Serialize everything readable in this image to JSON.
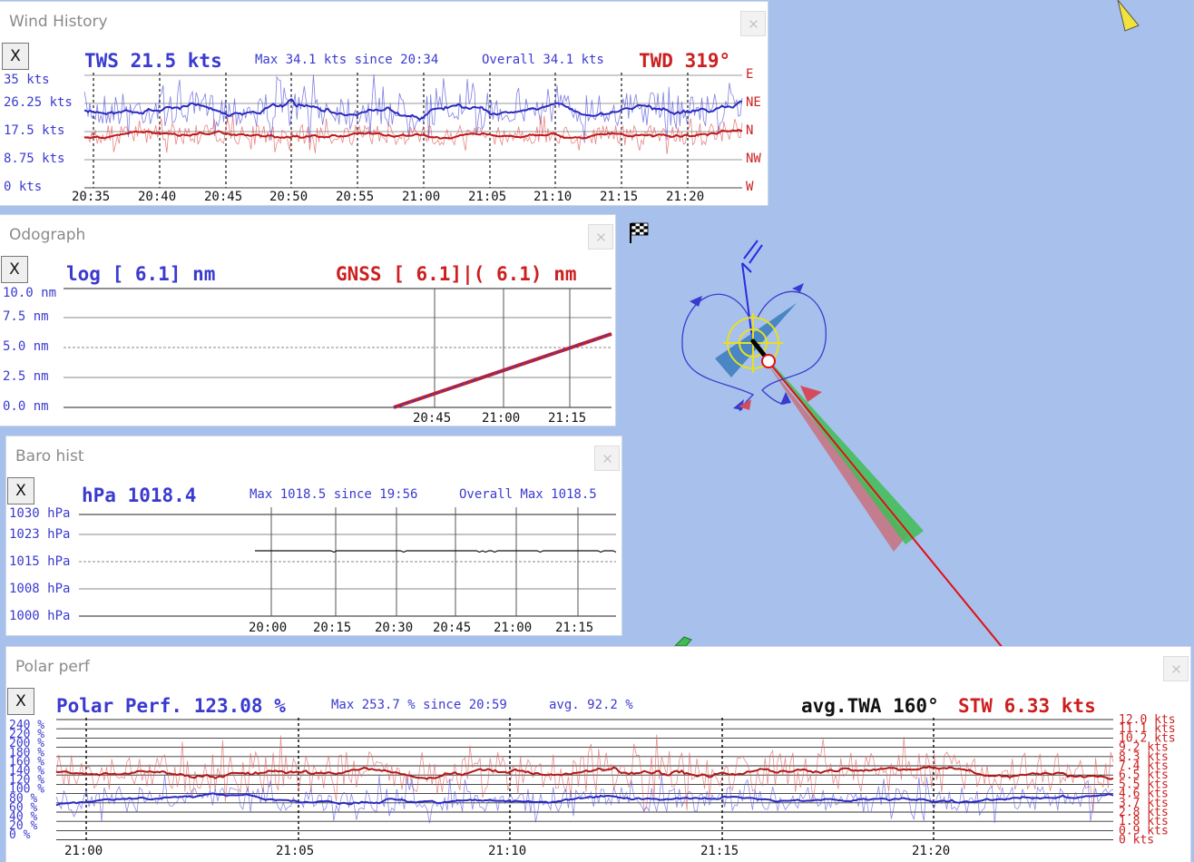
{
  "colors": {
    "blue": "#3a3ad0",
    "red": "#cc2020",
    "map_bg": "#a7c1ec"
  },
  "wind": {
    "title": "Wind History",
    "close": "X",
    "tws_label": "TWS 21.5 kts",
    "max_label": "Max 34.1 kts since 20:34",
    "overall_label": "Overall 34.1 kts",
    "twd_label": "TWD 319°",
    "y_left": [
      "35 kts",
      "26.25 kts",
      "17.5 kts",
      "8.75 kts",
      "0 kts"
    ],
    "y_right": [
      "E",
      "NE",
      "N",
      "NW",
      "W"
    ],
    "x_ticks": [
      "20:35",
      "20:40",
      "20:45",
      "20:50",
      "20:55",
      "21:00",
      "21:05",
      "21:10",
      "21:15",
      "21:20"
    ]
  },
  "odo": {
    "title": "Odograph",
    "close": "X",
    "log_label": "log [ 6.1] nm",
    "gnss_label": "GNSS [ 6.1]|( 6.1) nm",
    "y_left": [
      "10.0 nm",
      "7.5 nm",
      "5.0 nm",
      "2.5 nm",
      "0.0 nm"
    ],
    "x_ticks": [
      "20:45",
      "21:00",
      "21:15"
    ]
  },
  "baro": {
    "title": "Baro hist",
    "close": "X",
    "hpa_label": "hPa 1018.4",
    "max_label": "Max 1018.5 since 19:56",
    "overall_label": "Overall Max 1018.5",
    "y_left": [
      "1030 hPa",
      "1023 hPa",
      "1015 hPa",
      "1008 hPa",
      "1000 hPa"
    ],
    "x_ticks": [
      "20:00",
      "20:15",
      "20:30",
      "20:45",
      "21:00",
      "21:15"
    ]
  },
  "polar": {
    "title": "Polar perf",
    "close": "X",
    "perf_label": "Polar Perf. 123.08 %",
    "max_label": "Max 253.7 % since 20:59",
    "avg_label": "avg. 92.2 %",
    "twa_label": "avg.TWA 160°",
    "stw_label": "STW 6.33 kts",
    "y_left": [
      "240 %",
      "220 %",
      "200 %",
      "180 %",
      "160 %",
      "140 %",
      "120 %",
      "100 %",
      "80 %",
      "60 %",
      "40 %",
      "20 %",
      "0 %"
    ],
    "y_right": [
      "12.0 kts",
      "11.1 kts",
      "10.2 kts",
      "9.2 kts",
      "8.3 kts",
      "7.4 kts",
      "6.5 kts",
      "5.5 kts",
      "4.6 kts",
      "3.7 kts",
      "2.8 kts",
      "1.8 kts",
      "0.9 kts",
      "0 kts"
    ],
    "x_ticks": [
      "21:00",
      "21:05",
      "21:10",
      "21:15",
      "21:20"
    ]
  },
  "map": {
    "icons": [
      "wind-arrow-icon",
      "finish-flag-icon",
      "boat-icon",
      "waypoint-icon"
    ]
  }
}
